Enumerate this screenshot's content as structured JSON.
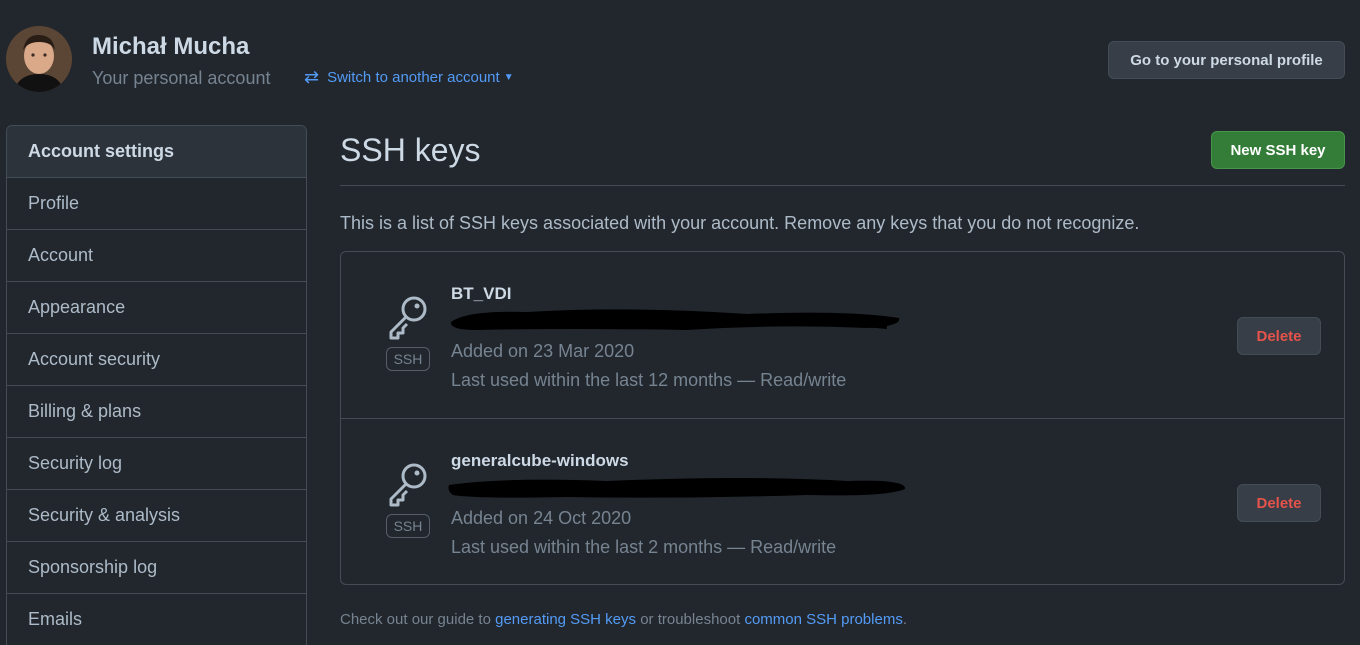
{
  "header": {
    "name": "Michał Mucha",
    "subtitle": "Your personal account",
    "switch_label": "Switch to another account",
    "profile_button": "Go to your personal profile"
  },
  "sidebar": {
    "items": [
      {
        "label": "Account settings"
      },
      {
        "label": "Profile"
      },
      {
        "label": "Account"
      },
      {
        "label": "Appearance"
      },
      {
        "label": "Account security"
      },
      {
        "label": "Billing & plans"
      },
      {
        "label": "Security log"
      },
      {
        "label": "Security & analysis"
      },
      {
        "label": "Sponsorship log"
      },
      {
        "label": "Emails"
      }
    ]
  },
  "main": {
    "title": "SSH keys",
    "new_button": "New SSH key",
    "intro": "This is a list of SSH keys associated with your account. Remove any keys that you do not recognize.",
    "keys": [
      {
        "title": "BT_VDI",
        "badge": "SSH",
        "added": "Added on 23 Mar 2020",
        "used": "Last used within the last 12 months — Read/write",
        "delete_label": "Delete"
      },
      {
        "title": "generalcube-windows",
        "badge": "SSH",
        "added": "Added on 24 Oct 2020",
        "used": "Last used within the last 2 months — Read/write",
        "delete_label": "Delete"
      }
    ],
    "footer": {
      "prefix": "Check out our guide to ",
      "link1": "generating SSH keys",
      "middle": " or troubleshoot ",
      "link2": "common SSH problems",
      "suffix": "."
    }
  },
  "colors": {
    "background": "#22272e",
    "accent_link": "#539bf5",
    "primary_button": "#347d39",
    "danger": "#e5534b"
  },
  "icons": {
    "key": "key-icon",
    "switch": "arrow-switch-icon",
    "caret": "caret-down-icon"
  }
}
